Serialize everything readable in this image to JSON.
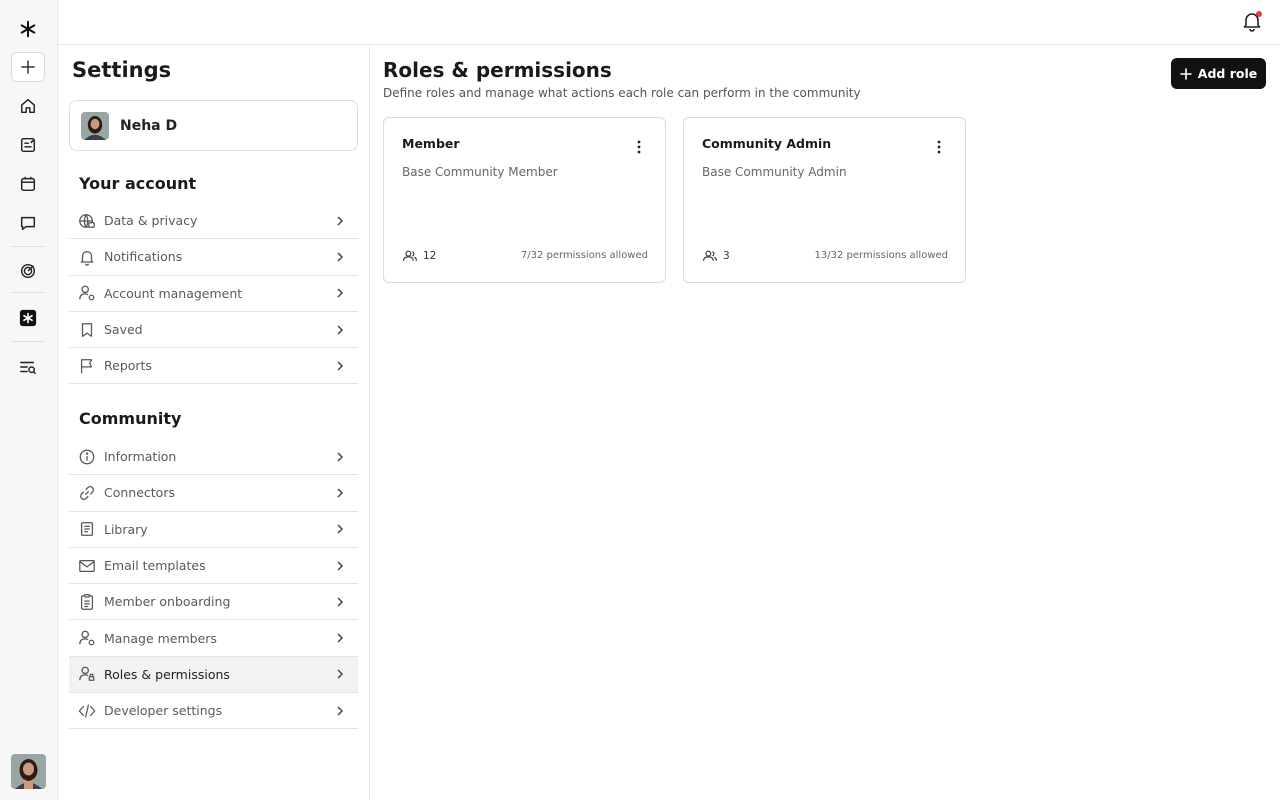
{
  "settings": {
    "title": "Settings",
    "profile_name": "Neha D",
    "account_section_title": "Your account",
    "account_items": [
      {
        "label": "Data & privacy",
        "icon": "globe-lock-icon"
      },
      {
        "label": "Notifications",
        "icon": "bell-icon"
      },
      {
        "label": "Account management",
        "icon": "user-gear-icon"
      },
      {
        "label": "Saved",
        "icon": "bookmark-icon"
      },
      {
        "label": "Reports",
        "icon": "flag-icon"
      }
    ],
    "community_section_title": "Community",
    "community_items": [
      {
        "label": "Information",
        "icon": "info-icon"
      },
      {
        "label": "Connectors",
        "icon": "link-icon"
      },
      {
        "label": "Library",
        "icon": "book-icon"
      },
      {
        "label": "Email templates",
        "icon": "mail-icon"
      },
      {
        "label": "Member onboarding",
        "icon": "clipboard-icon"
      },
      {
        "label": "Manage members",
        "icon": "user-gear-icon"
      },
      {
        "label": "Roles & permissions",
        "icon": "user-lock-icon",
        "active": true
      },
      {
        "label": "Developer settings",
        "icon": "code-icon"
      }
    ]
  },
  "main": {
    "title": "Roles & permissions",
    "subtitle": "Define roles and manage what actions each role can perform in the community",
    "add_role_label": "Add role",
    "roles": [
      {
        "name": "Member",
        "description": "Base Community Member",
        "member_count": "12",
        "permissions": "7/32 permissions allowed"
      },
      {
        "name": "Community Admin",
        "description": "Base Community Admin",
        "member_count": "3",
        "permissions": "13/32 permissions allowed"
      }
    ]
  },
  "colors": {
    "accent": "#111111",
    "notification_dot": "#e53935",
    "active_item_bg": "#f2f2f2"
  }
}
